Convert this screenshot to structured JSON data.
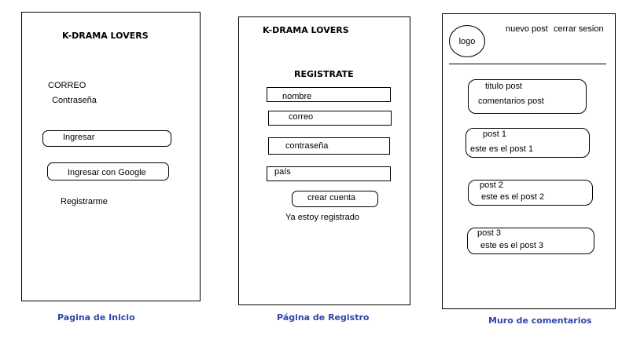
{
  "inicio": {
    "title": "K-DRAMA LOVERS",
    "correo": "CORREO",
    "contrasena": "Contraseña",
    "ingresar": "Ingresar",
    "ingresar_google": "Ingresar con Google",
    "registrarme": "Registrarme",
    "caption": "Pagina de Inicio"
  },
  "registro": {
    "title": "K-DRAMA LOVERS",
    "heading": "REGISTRATE",
    "nombre": "nombre",
    "correo": "correo",
    "contrasena": "contraseña",
    "pais": "país",
    "crear": "crear cuenta",
    "ya_registrado": "Ya estoy registrado",
    "caption": "Página de Registro"
  },
  "muro": {
    "logo": "logo",
    "nuevo_post": "nuevo post",
    "cerrar_sesion": "cerrar sesion",
    "posts": [
      {
        "title": "titulo post",
        "body": "comentarios post"
      },
      {
        "title": "post 1",
        "body": "este es el post 1"
      },
      {
        "title": "post 2",
        "body": "este es el post 2"
      },
      {
        "title": "post 3",
        "body": "este es el post 3"
      }
    ],
    "caption": "Muro de comentarios"
  },
  "colors": {
    "caption": "#2e46a8",
    "stroke": "#000000"
  }
}
